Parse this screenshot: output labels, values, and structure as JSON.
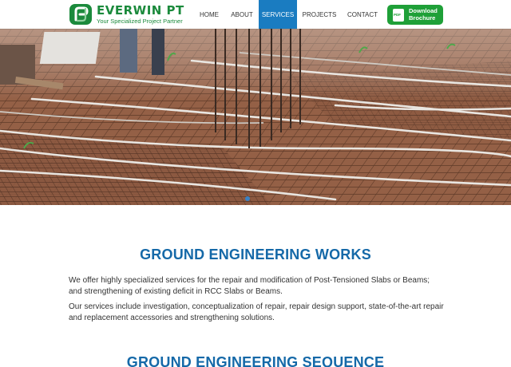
{
  "brand": {
    "name": "EVERWIN PT",
    "tagline": "Your Specialized Project Partner",
    "color": "#1b8a3c"
  },
  "nav": {
    "items": [
      {
        "label": "HOME"
      },
      {
        "label": "ABOUT"
      },
      {
        "label": "SERVICES",
        "active": true
      },
      {
        "label": "PROJECTS"
      },
      {
        "label": "CONTACT"
      }
    ],
    "active_color": "#1a7cc1"
  },
  "brochure": {
    "line1": "Download",
    "line2": "Brochure",
    "icon_text": "PDF",
    "color": "#1fa038"
  },
  "hero": {
    "image_icon": "construction-rebar-photo"
  },
  "main": {
    "section1_title": "GROUND ENGINEERING WORKS",
    "para1": "We offer highly specialized services for the repair and modification of Post-Tensioned Slabs or Beams; and strengthening of existing deficit in RCC Slabs or Beams.",
    "para2": "Our services include investigation, conceptualization of repair, repair design support, state-of-the-art repair and replacement accessories and strengthening solutions.",
    "section2_title": "GROUND ENGINEERING SEQUENCE",
    "title_color": "#1569a8"
  }
}
